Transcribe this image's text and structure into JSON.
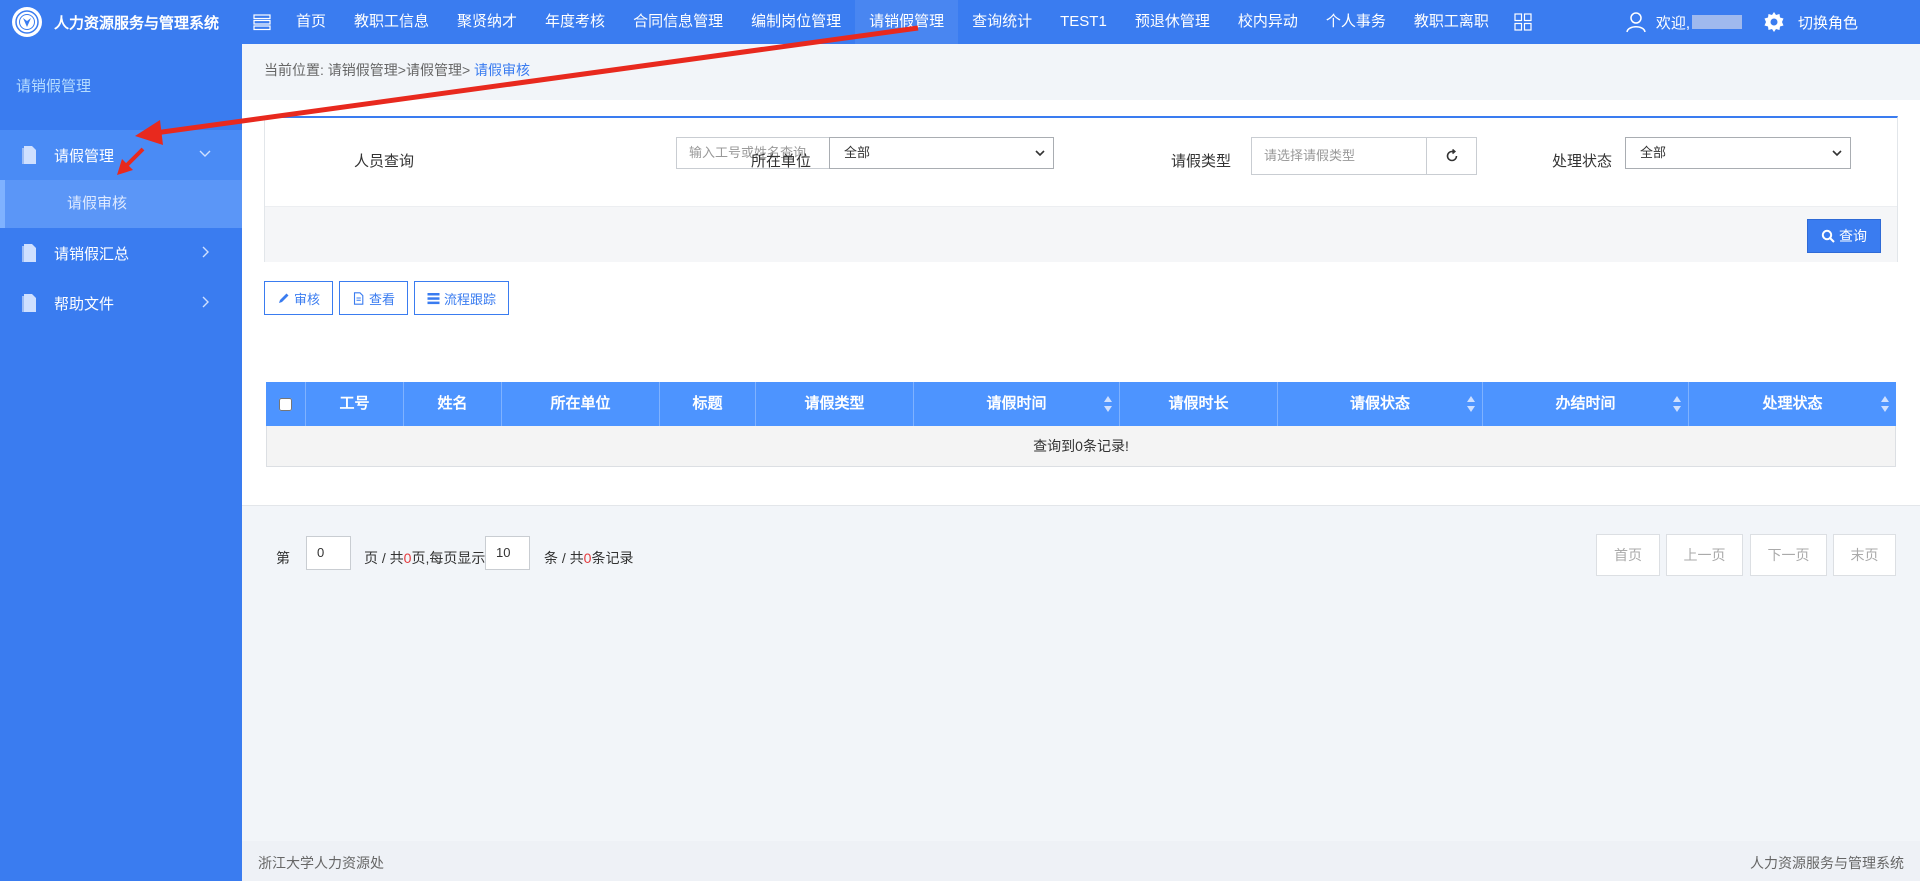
{
  "header": {
    "title": "人力资源服务与管理系统",
    "nav": [
      "首页",
      "教职工信息",
      "聚贤纳才",
      "年度考核",
      "合同信息管理",
      "编制岗位管理",
      "请销假管理",
      "查询统计",
      "TEST1",
      "预退休管理",
      "校内异动",
      "个人事务",
      "教职工离职"
    ],
    "welcome": "欢迎,",
    "switch_role": "切换角色"
  },
  "sidebar": {
    "title": "请销假管理",
    "items": [
      {
        "label": "请假管理",
        "sub": [
          "请假审核"
        ]
      },
      {
        "label": "请销假汇总"
      },
      {
        "label": "帮助文件"
      }
    ]
  },
  "breadcrumb": {
    "prefix": "当前位置:",
    "path": "请销假管理>请假管理>",
    "current": "请假审核"
  },
  "filters": {
    "person_label": "人员查询",
    "person_placeholder": "输入工号或姓名查询",
    "unit_label": "所在单位",
    "unit_value": "全部",
    "leave_type_label": "请假类型",
    "leave_type_placeholder": "请选择请假类型",
    "status_label": "处理状态",
    "status_value": "全部",
    "query_button": "查询"
  },
  "toolbar": {
    "audit": "审核",
    "view": "查看",
    "track": "流程跟踪"
  },
  "table": {
    "columns": [
      "工号",
      "姓名",
      "所在单位",
      "标题",
      "请假类型",
      "请假时间",
      "请假时长",
      "请假状态",
      "办结时间",
      "处理状态"
    ],
    "empty_text": "查询到0条记录!"
  },
  "pager": {
    "page_label": "第",
    "page_value": "0",
    "page_total_pre": "页 / 共",
    "page_total": "0",
    "page_total_post": "页,每页显示",
    "size_value": "10",
    "records_pre": "条 / 共",
    "records": "0",
    "records_post": "条记录",
    "first": "首页",
    "prev": "上一页",
    "next": "下一页",
    "last": "末页"
  },
  "footer": {
    "left": "浙江大学人力资源处",
    "right": "人力资源服务与管理系统"
  },
  "colors": {
    "primary": "#3a7cf0",
    "table_header": "#4d94ff",
    "annotation": "#e8291e"
  }
}
